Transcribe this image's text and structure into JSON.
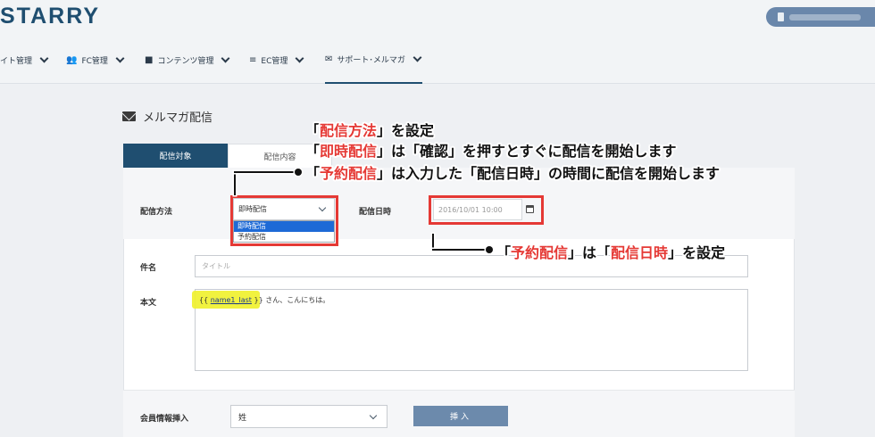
{
  "header": {
    "logo": "STARRY"
  },
  "nav": {
    "items": [
      {
        "label": "イト管理",
        "icon": "none"
      },
      {
        "label": "FC管理",
        "icon": "users-icon"
      },
      {
        "label": "コンテンツ管理",
        "icon": "folder-icon"
      },
      {
        "label": "EC管理",
        "icon": "cart-icon"
      },
      {
        "label": "サポート･メルマガ",
        "icon": "envelope-icon"
      }
    ]
  },
  "page": {
    "title": "メルマガ配信",
    "tabs": [
      "配信対象",
      "配信内容"
    ]
  },
  "form": {
    "method_label": "配信方法",
    "method_value": "即時配信",
    "method_options": [
      "即時配信",
      "予約配信"
    ],
    "datetime_label": "配信日時",
    "datetime_placeholder": "2016/10/01 10:00",
    "subject_label": "件名",
    "subject_placeholder": "タイトル",
    "body_label": "本文",
    "body_prefix": "{{ ",
    "body_variable": "name1_last",
    "body_suffix": " }} さん、こんにちは。",
    "member_label": "会員情報挿入",
    "member_value": "姓",
    "insert_button": "挿入"
  },
  "annotations": {
    "line1_red": "配信方法",
    "line1_rest": "」を設定",
    "line2_red": "即時配信",
    "line2_rest": "」は「確認」を押すとすぐに配信を開始します",
    "line3_red": "予約配信",
    "line3_rest": "」は入力した「配信日時」の時間に配信を開始します",
    "bottom_red1": "予約配信",
    "bottom_mid": "」は「",
    "bottom_red2": "配信日時",
    "bottom_rest": "」を設定",
    "open_bracket": "「",
    "highlight_color": "#e53935"
  }
}
